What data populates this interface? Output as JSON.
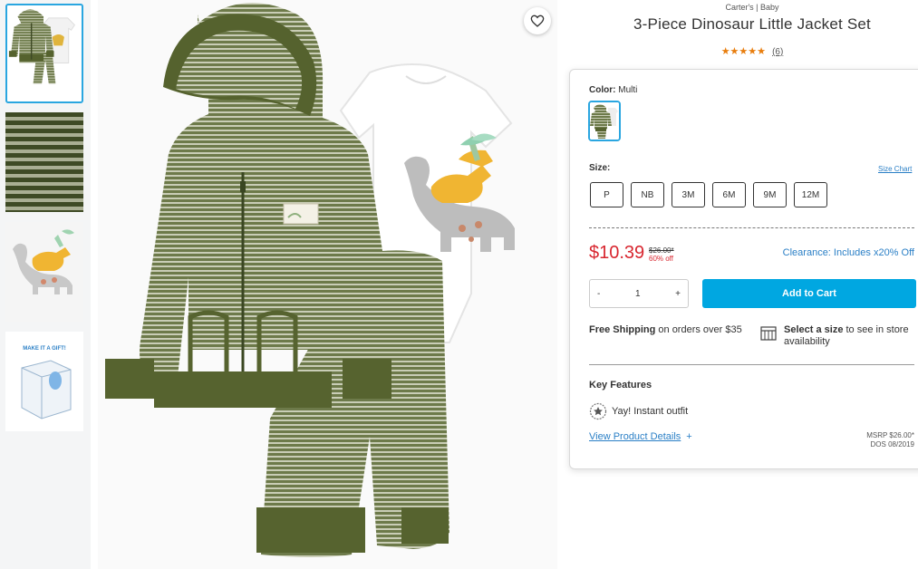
{
  "product": {
    "brand": "Carter's | Baby",
    "title": "3-Piece Dinosaur Little Jacket Set",
    "stars": "★★★★★",
    "review_count": "(6)"
  },
  "thumbnails": [
    {
      "name": "jacket-set-thumb"
    },
    {
      "name": "stripe-fabric-thumb"
    },
    {
      "name": "dinosaur-print-thumb"
    },
    {
      "name": "gift-box-thumb",
      "text": "MAKE IT A GIFT!"
    }
  ],
  "color": {
    "label": "Color:",
    "value": "Multi"
  },
  "size": {
    "label": "Size:",
    "chart_link": "Size Chart",
    "options": [
      "P",
      "NB",
      "3M",
      "6M",
      "9M",
      "12M"
    ]
  },
  "pricing": {
    "price": "$10.39",
    "was": "$26.00*",
    "off": "60% off",
    "clearance": "Clearance: Includes x20% Off"
  },
  "cart": {
    "minus": "-",
    "quantity": "1",
    "plus": "+",
    "add_label": "Add to Cart"
  },
  "shipping": {
    "bold": "Free Shipping",
    "rest": " on orders over $35"
  },
  "store": {
    "bold": "Select a size",
    "rest": " to see in store availability"
  },
  "features": {
    "title": "Key Features",
    "items": [
      "Yay! Instant outfit"
    ],
    "details_link": "View Product Details",
    "details_plus": "+"
  },
  "msrp": {
    "line1": "MSRP $26.00*",
    "line2": "DOS 08/2019"
  },
  "colors": {
    "accent_blue": "#00a7e1",
    "link_blue": "#2a7fc6",
    "sale_red": "#d8262f",
    "star_orange": "#e87d0d",
    "olive": "#5c6b3a"
  }
}
